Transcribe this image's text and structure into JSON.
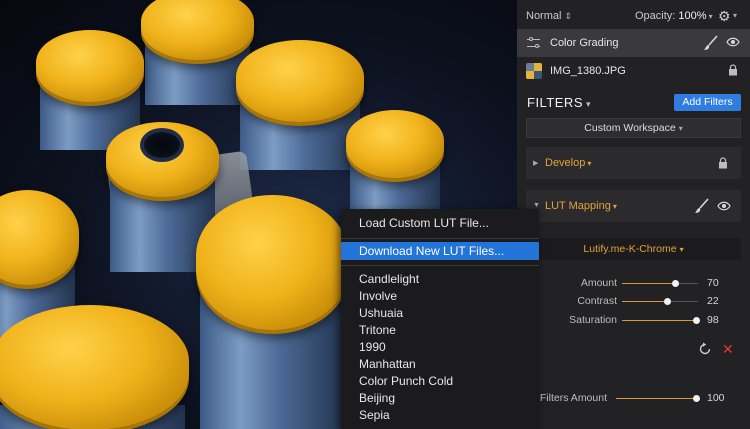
{
  "canvas": {
    "image_name": "IMG_1380.JPG"
  },
  "blend": {
    "mode": "Normal",
    "opacity_label": "Opacity:",
    "opacity_value": "100%"
  },
  "layers": [
    {
      "label": "Color Grading",
      "active": true
    },
    {
      "label": "IMG_1380.JPG",
      "active": false
    }
  ],
  "filters": {
    "header": "FILTERS",
    "add_button": "Add Filters",
    "workspace": "Custom Workspace",
    "develop": {
      "title": "Develop"
    },
    "lut": {
      "title": "LUT Mapping",
      "selected_lut": "Lutify.me-K-Chrome",
      "params": [
        {
          "label": "Amount",
          "value": "70",
          "fraction": 0.7
        },
        {
          "label": "Contrast",
          "value": "22",
          "fraction": 0.59
        },
        {
          "label": "Saturation",
          "value": "98",
          "fraction": 0.98
        }
      ]
    },
    "filters_amount": {
      "label": "Filters Amount",
      "value": "100",
      "fraction": 1.0
    }
  },
  "menu": {
    "items": [
      {
        "label": "Load Custom LUT File...",
        "highlight": false
      },
      {
        "label": "Download New LUT Files...",
        "highlight": true
      },
      {
        "label": "Candlelight",
        "highlight": false
      },
      {
        "label": "Involve",
        "highlight": false
      },
      {
        "label": "Ushuaia",
        "highlight": false
      },
      {
        "label": "Tritone",
        "highlight": false
      },
      {
        "label": "1990",
        "highlight": false
      },
      {
        "label": "Manhattan",
        "highlight": false
      },
      {
        "label": "Color Punch Cold",
        "highlight": false
      },
      {
        "label": "Beijing",
        "highlight": false
      },
      {
        "label": "Sepia",
        "highlight": false
      }
    ]
  },
  "colors": {
    "accent_blue": "#2f7de0",
    "accent_orange": "#e2a23a",
    "delete_red": "#e03b2a"
  }
}
